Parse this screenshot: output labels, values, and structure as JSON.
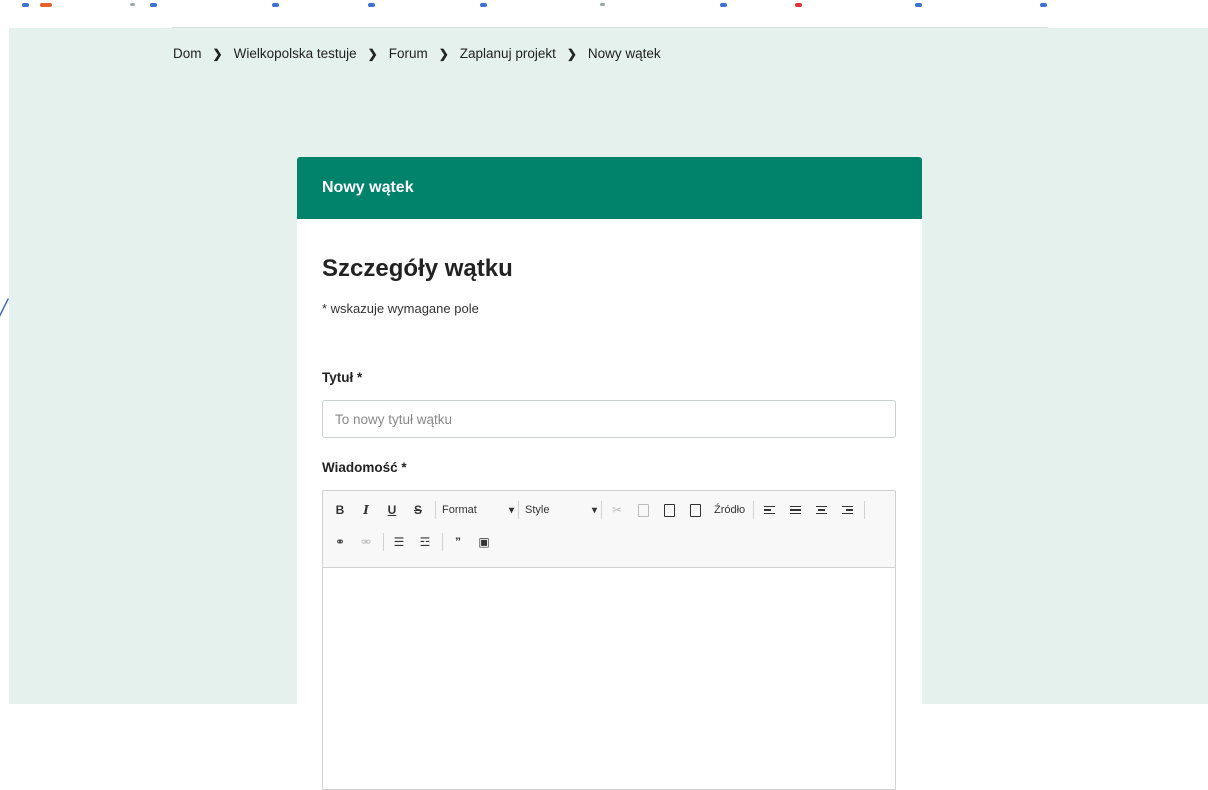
{
  "breadcrumb": {
    "items": [
      "Dom",
      "Wielkopolska testuje",
      "Forum",
      "Zaplanuj projekt",
      "Nowy wątek"
    ]
  },
  "card": {
    "header_title": "Nowy wątek",
    "section_title": "Szczegóły wątku",
    "required_note": "* wskazuje wymagane pole",
    "title_label": "Tytuł *",
    "title_placeholder": "To nowy tytuł wątku",
    "message_label": "Wiadomość *"
  },
  "toolbar": {
    "bold": "B",
    "italic": "I",
    "underline": "U",
    "strike": "S",
    "format_label": "Format",
    "style_label": "Style",
    "source_label": "Źródło",
    "icons": [
      "cut-icon",
      "copy-icon",
      "paste-icon",
      "paste-text-icon",
      "source-icon",
      "align-left-icon",
      "align-justify-icon",
      "align-center-icon",
      "align-right-icon",
      "link-icon",
      "unlink-icon",
      "bulleted-list-icon",
      "numbered-list-icon",
      "blockquote-icon",
      "image-icon"
    ]
  },
  "colors": {
    "header_green": "#00826b",
    "page_bg": "#e4f1ed"
  }
}
